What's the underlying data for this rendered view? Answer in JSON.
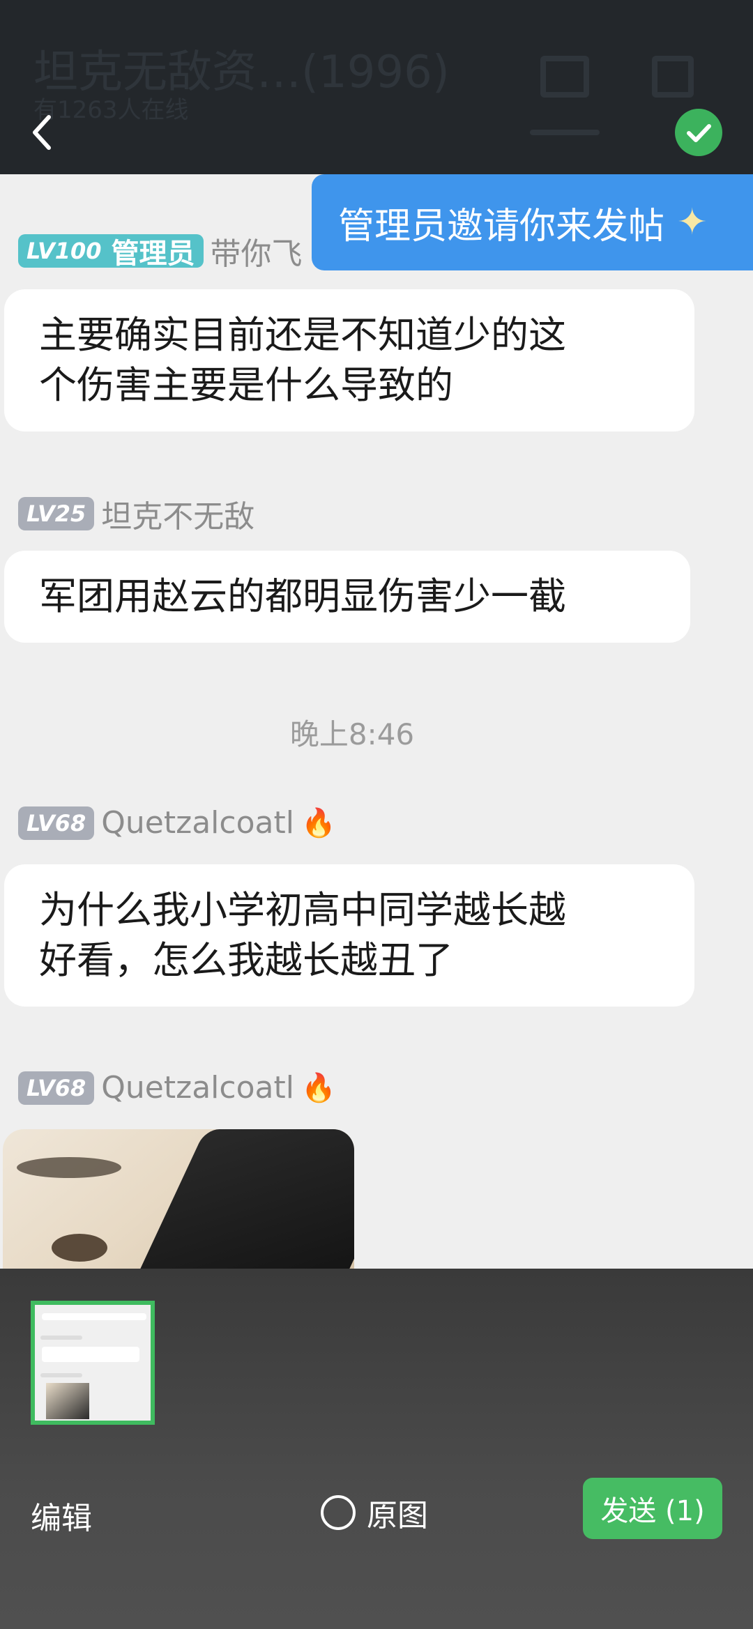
{
  "header": {
    "group_title": "坦克无敌资…(1996)",
    "online_text": "有1263人在线"
  },
  "invite": {
    "text": "管理员邀请你来发帖",
    "icon": "sparkle-icon"
  },
  "messages": [
    {
      "level": "LV100",
      "role": "管理员",
      "name": "带你飞",
      "text_lines": [
        "主要确实目前还是不知道少的这",
        "个伤害主要是什么导致的"
      ]
    },
    {
      "level": "LV25",
      "name": "坦克不无敌",
      "text_lines": [
        "军团用赵云的都明显伤害少一截"
      ]
    },
    {
      "level": "LV68",
      "name": "Quetzalcoatl",
      "badge": "🔥",
      "text_lines": [
        "为什么我小学初高中同学越长越",
        "好看，怎么我越长越丑了"
      ]
    },
    {
      "level": "LV68",
      "name": "Quetzalcoatl",
      "badge": "🔥",
      "image": "cat-photo"
    }
  ],
  "timestamp": "晚上8:46",
  "bottom": {
    "edit_label": "编辑",
    "original_label": "原图",
    "send_label": "发送 (1)"
  },
  "colors": {
    "accent_green": "#46bc63",
    "banner_blue": "#3f95ec",
    "admin_badge": "#55c2c9"
  }
}
